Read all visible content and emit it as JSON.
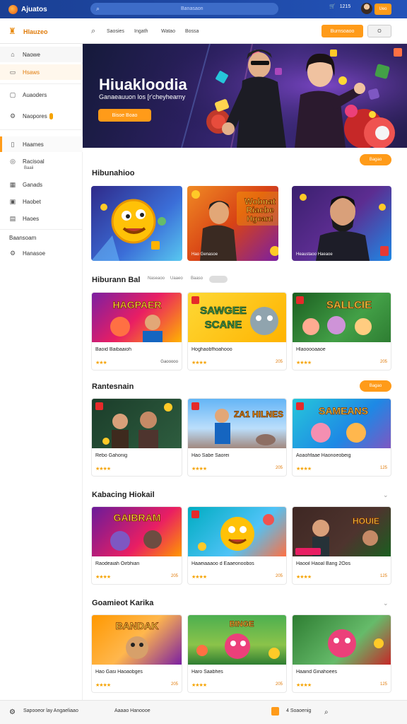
{
  "topbar": {
    "app_name": "Ajuatos",
    "search_placeholder": "Banasaon",
    "icon_label": "1215",
    "button": "Ueo"
  },
  "header": {
    "brand": "Hlauzeo",
    "links": [
      "Saosies",
      "Ingath",
      "Watao",
      "Bossa"
    ],
    "primary_button": "Burnsoaoo",
    "secondary_button": "O"
  },
  "sidebar": {
    "items": [
      {
        "label": "Naowe",
        "icon": "home-icon"
      },
      {
        "label": "Hsaws",
        "icon": "star-icon"
      },
      {
        "label": "Auaoders",
        "icon": "calendar-icon"
      },
      {
        "label": "Naopores",
        "icon": "gear-icon"
      },
      {
        "label": "Haames",
        "icon": "bookmark-icon"
      },
      {
        "label": "Racisoal",
        "icon": "target-icon"
      },
      {
        "label": "Ganads",
        "icon": "grid-icon"
      },
      {
        "label": "Haobet",
        "icon": "inbox-icon"
      },
      {
        "label": "Haoes",
        "icon": "list-icon"
      },
      {
        "label": "Hanasoe",
        "icon": "gear-icon"
      }
    ],
    "sub_label": "Baaii",
    "group_head": "Baansoam"
  },
  "hero": {
    "title": "Hiuakloodia",
    "subtitle": "Ganaeauuon los [r'cheyhearny",
    "button": "Bisoe Boao"
  },
  "sections": [
    {
      "title": "Hibunahioo",
      "chip": "Bagao",
      "cards": [
        {
          "caption": ""
        },
        {
          "caption": "Hao Genasoe"
        },
        {
          "caption": "Heaustaoo Haeaoe"
        }
      ]
    },
    {
      "title": "Hiburann Bal",
      "tabs": [
        "Naseaoo",
        "Uaaeo",
        "Baaso"
      ],
      "cards": [
        {
          "title": "Baoid Baibaaioh",
          "stars": "★★★",
          "num": "Gaooooo",
          "overlay": "HAGPAER"
        },
        {
          "title": "Hoghaobfhoahooo",
          "stars": "★★★★",
          "num": "205",
          "overlay": "SAWGEE SCANE"
        },
        {
          "title": "Hlaooooaaoe",
          "stars": "★★★★",
          "num": "205",
          "overlay": "SALLCIE"
        }
      ]
    },
    {
      "title": "Rantesnain",
      "chip": "Bagao",
      "cards": [
        {
          "title": "Rebo Gahonig",
          "stars": "★★★★",
          "num": "",
          "overlay": ""
        },
        {
          "title": "Hao Sabe Saorei",
          "stars": "★★★★",
          "num": "205",
          "overlay": "ZA1 HILNES"
        },
        {
          "title": "Aoaohfaae Haonoeobeig",
          "stars": "★★★★",
          "num": "125",
          "overlay": "SAMEANS"
        }
      ]
    },
    {
      "title": "Kabacing Hiokail",
      "cards": [
        {
          "title": "Raodeaiah Oirbhian",
          "stars": "★★★★",
          "num": "205",
          "overlay": "GAIBRAM"
        },
        {
          "title": "Haaeiaaaoo d Eaaeonoobos",
          "stars": "★★★★",
          "num": "205",
          "overlay": ""
        },
        {
          "title": "Haooil Haoal Bang 2Oos",
          "stars": "★★★★",
          "num": "125",
          "overlay": "HOUIE"
        }
      ]
    },
    {
      "title": "Goamieot Karika",
      "cards": [
        {
          "title": "Hao Gasi Haoaobges",
          "stars": "★★★★",
          "num": "205",
          "overlay": "BANDAK"
        },
        {
          "title": "Haro Saabhes",
          "stars": "★★★★",
          "num": "205",
          "overlay": "BINGE"
        },
        {
          "title": "Haaind Ginahoees",
          "stars": "★★★★",
          "num": "125",
          "overlay": ""
        }
      ]
    }
  ],
  "footer": {
    "left": "Sapooeor lay Angaeliaao",
    "middle": "Aaaao Hanoooe",
    "right": "4 Soaoenig"
  }
}
